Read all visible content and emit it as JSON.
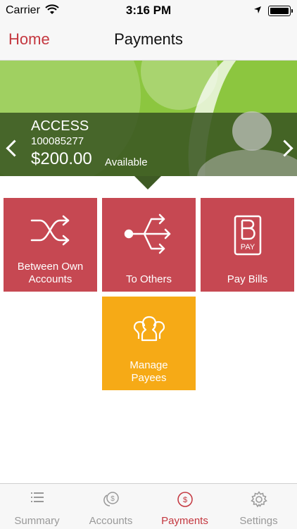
{
  "status_bar": {
    "carrier": "Carrier",
    "time": "3:16 PM"
  },
  "nav": {
    "back_label": "Home",
    "title": "Payments"
  },
  "account": {
    "name": "ACCESS",
    "number": "100085277",
    "balance": "$200.00",
    "balance_caption": "Available"
  },
  "tiles": [
    {
      "label": "Between Own\nAccounts",
      "icon": "shuffle-icon"
    },
    {
      "label": "To Others",
      "icon": "branching-arrows-icon"
    },
    {
      "label": "Pay Bills",
      "icon": "bpay-icon",
      "icon_text": "PAY"
    },
    {
      "label": "Manage\nPayees",
      "icon": "people-group-icon"
    }
  ],
  "tab_bar": [
    {
      "label": "Summary",
      "icon": "list-icon"
    },
    {
      "label": "Accounts",
      "icon": "coins-icon",
      "icon_text": "$"
    },
    {
      "label": "Payments",
      "icon": "dollar-circle-icon",
      "icon_text": "$",
      "active": true
    },
    {
      "label": "Settings",
      "icon": "gear-icon"
    }
  ],
  "colors": {
    "accent": "#c4373f",
    "tile_red": "#c64852",
    "tile_orange": "#f6aa16",
    "banner_green": "#8cc63f",
    "banner_band": "#3a5622"
  }
}
